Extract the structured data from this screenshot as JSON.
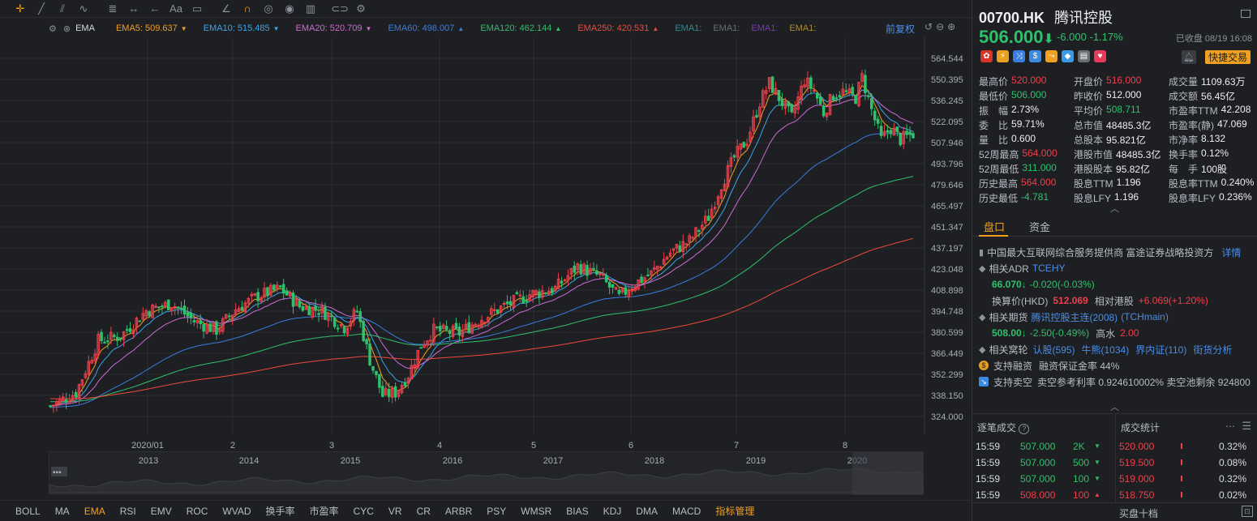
{
  "toolbar": {
    "icons": [
      "crosshair-icon",
      "line-icon",
      "channel-icon",
      "pattern-icon",
      "fib-icon",
      "measure-icon",
      "arrow-icon",
      "text-icon",
      "note-icon",
      "brush-icon",
      "magnet-icon",
      "eye-icon",
      "hide-icon",
      "trash-icon",
      "link-icon",
      "gear-icon"
    ]
  },
  "indicators": {
    "label": "EMA",
    "items": [
      {
        "text": "EMA5: 509.637",
        "color": "#f0a020",
        "arrow": "▼"
      },
      {
        "text": "EMA10: 515.485",
        "color": "#3aa6e8",
        "arrow": "▼"
      },
      {
        "text": "EMA20: 520.709",
        "color": "#d06ad8",
        "arrow": "▼"
      },
      {
        "text": "EMA60: 498.007",
        "color": "#3a7de0",
        "arrow": "▲"
      },
      {
        "text": "EMA120: 462.144",
        "color": "#2fc06b",
        "arrow": "▲"
      },
      {
        "text": "EMA250: 420.531",
        "color": "#ee4a3a",
        "arrow": "▲"
      },
      {
        "text": "EMA1:",
        "color": "#2a8a9a",
        "arrow": ""
      },
      {
        "text": "EMA1:",
        "color": "#6a6d74",
        "arrow": ""
      },
      {
        "text": "EMA1:",
        "color": "#7a3ab0",
        "arrow": ""
      },
      {
        "text": "EMA1:",
        "color": "#a88a3a",
        "arrow": ""
      }
    ],
    "adjust": "前复权"
  },
  "chart_data": {
    "type": "candlestick",
    "y_ticks": [
      "564.544",
      "550.395",
      "536.245",
      "522.095",
      "507.946",
      "493.796",
      "479.646",
      "465.497",
      "451.347",
      "437.197",
      "423.048",
      "408.898",
      "394.748",
      "380.599",
      "366.449",
      "352.299",
      "338.150",
      "324.000"
    ],
    "ylim": [
      324.0,
      564.544
    ],
    "x_ticks": [
      "2020/01",
      "2",
      "3",
      "4",
      "5",
      "6",
      "7",
      "8"
    ],
    "anchors": [
      [
        0,
        331
      ],
      [
        8,
        340
      ],
      [
        15,
        375
      ],
      [
        22,
        378
      ],
      [
        30,
        395
      ],
      [
        38,
        400
      ],
      [
        45,
        388
      ],
      [
        52,
        382
      ],
      [
        58,
        396
      ],
      [
        65,
        405
      ],
      [
        72,
        410
      ],
      [
        78,
        398
      ],
      [
        85,
        395
      ],
      [
        92,
        384
      ],
      [
        96,
        395
      ],
      [
        100,
        362
      ],
      [
        104,
        338
      ],
      [
        108,
        340
      ],
      [
        112,
        352
      ],
      [
        116,
        372
      ],
      [
        120,
        382
      ],
      [
        128,
        380
      ],
      [
        135,
        390
      ],
      [
        142,
        398
      ],
      [
        150,
        406
      ],
      [
        158,
        410
      ],
      [
        165,
        425
      ],
      [
        172,
        418
      ],
      [
        178,
        404
      ],
      [
        182,
        412
      ],
      [
        188,
        420
      ],
      [
        194,
        434
      ],
      [
        200,
        442
      ],
      [
        206,
        458
      ],
      [
        210,
        480
      ],
      [
        214,
        498
      ],
      [
        218,
        510
      ],
      [
        222,
        535
      ],
      [
        225,
        548
      ],
      [
        228,
        538
      ],
      [
        232,
        525
      ],
      [
        236,
        550
      ],
      [
        239,
        543
      ],
      [
        242,
        528
      ],
      [
        245,
        540
      ],
      [
        248,
        542
      ],
      [
        252,
        538
      ],
      [
        254,
        552
      ],
      [
        257,
        530
      ],
      [
        260,
        510
      ],
      [
        263,
        518
      ],
      [
        266,
        510
      ],
      [
        270,
        514
      ]
    ],
    "series": [
      {
        "name": "EMA5",
        "color": "#f0a020"
      },
      {
        "name": "EMA10",
        "color": "#3aa6e8"
      },
      {
        "name": "EMA20",
        "color": "#d06ad8"
      },
      {
        "name": "EMA60",
        "color": "#3a7de0"
      },
      {
        "name": "EMA120",
        "color": "#2fc06b"
      },
      {
        "name": "EMA250",
        "color": "#ee4a3a"
      }
    ],
    "up_color": "#ee3f4a",
    "down_color": "#2fc06b"
  },
  "navigator": {
    "years": [
      "2013",
      "2014",
      "2015",
      "2016",
      "2017",
      "2018",
      "2019",
      "2020"
    ]
  },
  "bottom_tabs": [
    "BOLL",
    "MA",
    "EMA",
    "RSI",
    "EMV",
    "ROC",
    "WVAD",
    "换手率",
    "市盈率",
    "CYC",
    "VR",
    "CR",
    "ARBR",
    "PSY",
    "WMSR",
    "BIAS",
    "KDJ",
    "DMA",
    "MACD",
    "指标管理"
  ],
  "stock": {
    "code": "00700.HK",
    "name": "腾讯控股",
    "price": "506.000",
    "arrow": "⬇",
    "change": "-6.000",
    "change_pct": "-1.17%",
    "status": "已收盘 08/19 16:08",
    "trade_button": "快捷交易"
  },
  "quote_rows": [
    [
      [
        "最高价",
        "520.000",
        "up"
      ],
      [
        "开盘价",
        "516.000",
        "up"
      ],
      [
        "成交量",
        "1109.63万",
        ""
      ]
    ],
    [
      [
        "最低价",
        "506.000",
        "dn"
      ],
      [
        "昨收价",
        "512.000",
        ""
      ],
      [
        "成交额",
        "56.45亿",
        ""
      ]
    ],
    [
      [
        "振　幅",
        "2.73%",
        ""
      ],
      [
        "平均价",
        "508.711",
        "dn"
      ],
      [
        "市盈率TTM",
        "42.208",
        ""
      ]
    ],
    [
      [
        "委　比",
        "59.71%",
        ""
      ],
      [
        "总市值",
        "48485.3亿",
        ""
      ],
      [
        "市盈率(静)",
        "47.069",
        ""
      ]
    ],
    [
      [
        "量　比",
        "0.600",
        ""
      ],
      [
        "总股本",
        "95.821亿",
        ""
      ],
      [
        "市净率",
        "8.132",
        ""
      ]
    ],
    [
      [
        "52周最高",
        "564.000",
        "up"
      ],
      [
        "港股市值",
        "48485.3亿",
        ""
      ],
      [
        "换手率",
        "0.12%",
        ""
      ]
    ],
    [
      [
        "52周最低",
        "311.000",
        "dn"
      ],
      [
        "港股股本",
        "95.82亿",
        ""
      ],
      [
        "每　手",
        "100股",
        ""
      ]
    ],
    [
      [
        "历史最高",
        "564.000",
        "up"
      ],
      [
        "股息TTM",
        "1.196",
        ""
      ],
      [
        "股息率TTM",
        "0.240%",
        ""
      ]
    ],
    [
      [
        "历史最低",
        "-4.781",
        "dn"
      ],
      [
        "股息LFY",
        "1.196",
        ""
      ],
      [
        "股息率LFY",
        "0.236%",
        ""
      ]
    ]
  ],
  "tabs": [
    "盘口",
    "资金"
  ],
  "info": {
    "desc": "中国最大互联网综合服务提供商 富途证券战略投资方",
    "detail": "详情",
    "adr_label": "相关ADR",
    "adr_code": "TCEHY",
    "adr_price": "66.070↓",
    "adr_chg": "-0.020(-0.03%)",
    "conv_label": "换算价(HKD)",
    "conv_val": "512.069",
    "rel_label": "相对港股",
    "rel_val": "+6.069(+1.20%)",
    "fut_label": "相关期货",
    "fut_name": "腾讯控股主连(2008)",
    "fut_code": "(TCHmain)",
    "fut_price": "508.00↓",
    "fut_chg": "-2.50(-0.49%)",
    "fut_hw_label": "高水",
    "fut_hw": "2.00",
    "war_label": "相关窝轮",
    "war_1": "认股(595)",
    "war_2": "牛熊(1034)",
    "war_3": "界内证(110)",
    "war_4": "街货分析",
    "margin_label": "支持融资",
    "margin_val": "融资保证金率 44%",
    "short_label": "支持卖空",
    "short_val": "卖空参考利率 0.924610002%  卖空池剩余 924800"
  },
  "trades": {
    "title": "逐笔成交",
    "rows": [
      [
        "15:59",
        "507.000",
        "2K",
        "dn"
      ],
      [
        "15:59",
        "507.000",
        "500",
        "dn"
      ],
      [
        "15:59",
        "507.000",
        "100",
        "dn"
      ],
      [
        "15:59",
        "508.000",
        "100",
        "up"
      ]
    ]
  },
  "stats": {
    "title": "成交统计",
    "rows": [
      [
        "520.000",
        "0.32%"
      ],
      [
        "519.500",
        "0.08%"
      ],
      [
        "519.000",
        "0.32%"
      ],
      [
        "518.750",
        "0.02%"
      ]
    ]
  },
  "rbottom": "买盘十档"
}
